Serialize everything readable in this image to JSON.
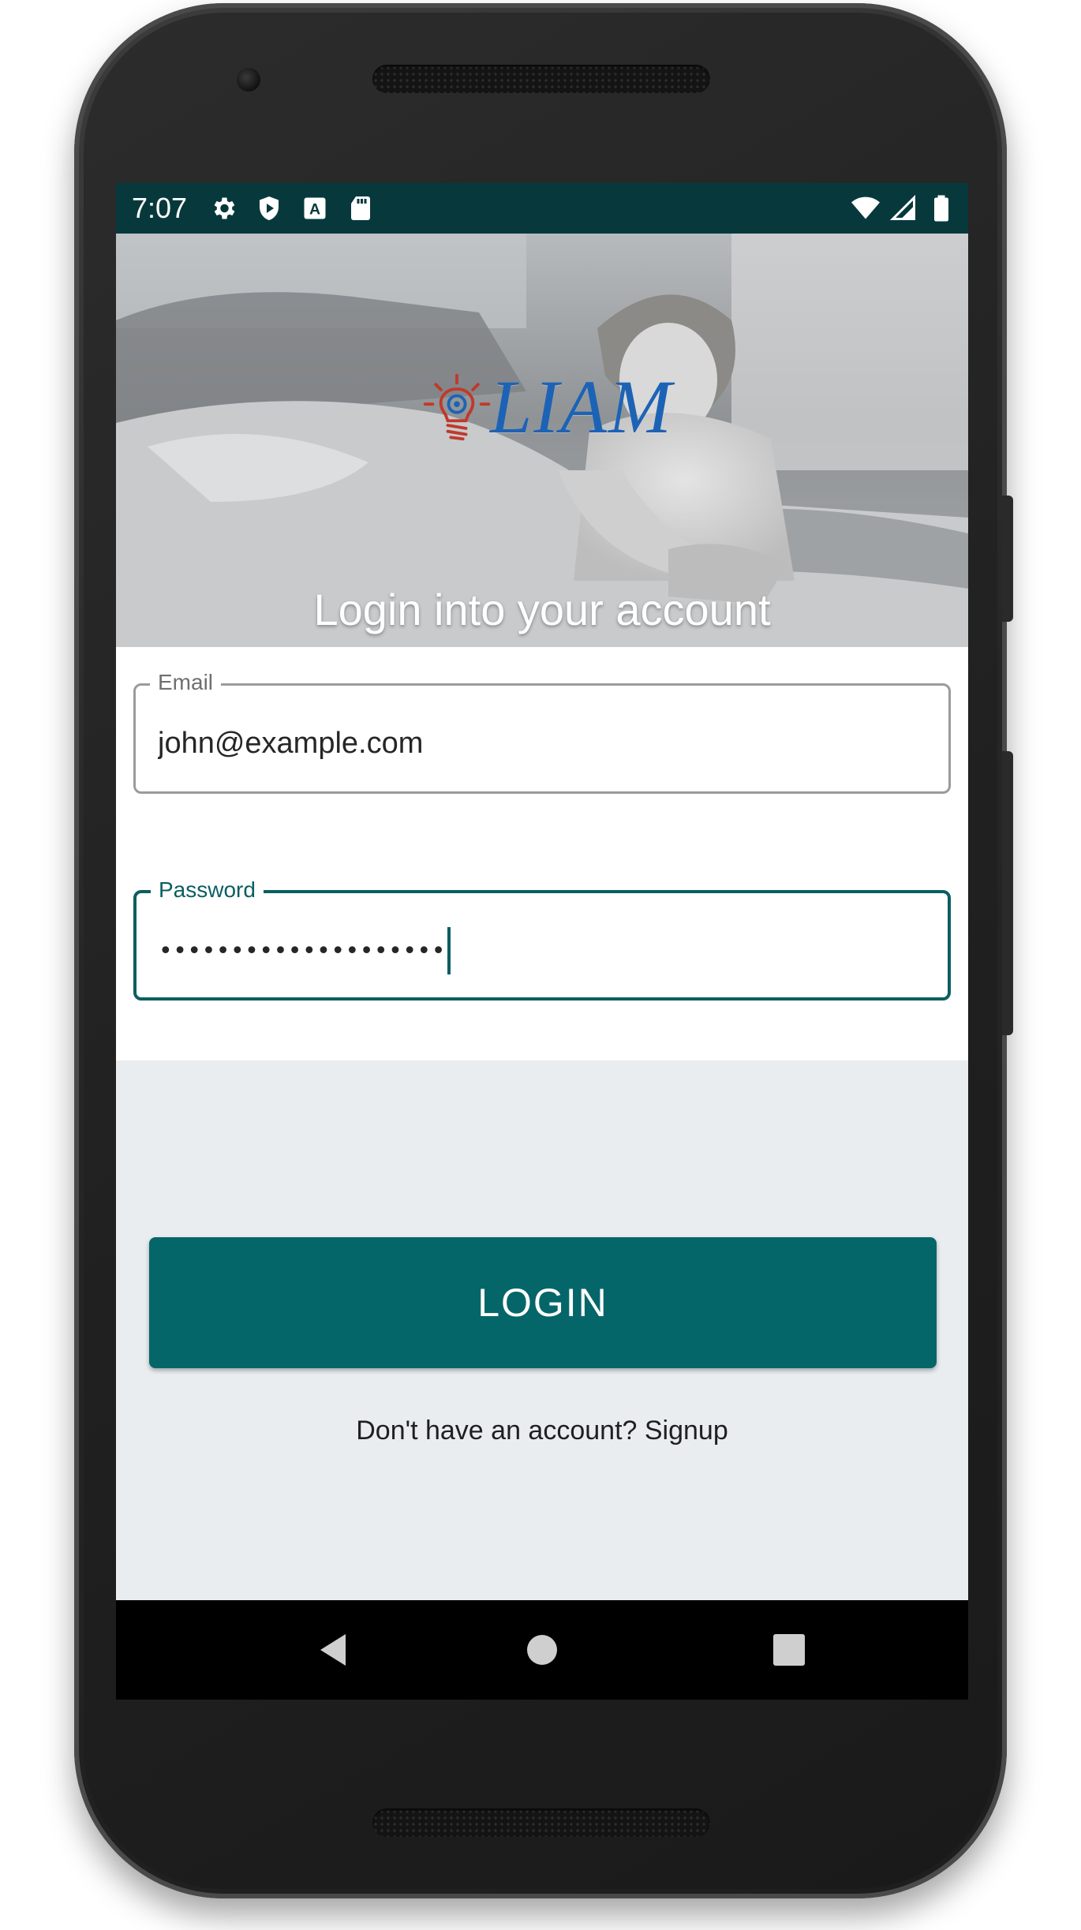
{
  "status_bar": {
    "time": "7:07",
    "left_icons": [
      "gear-icon",
      "shield-icon",
      "font-icon",
      "sd-card-icon"
    ],
    "right_icons": [
      "wifi-icon",
      "signal-icon",
      "battery-icon"
    ],
    "background_color": "#07393c"
  },
  "header": {
    "logo_text": "LIAM",
    "title": "Login into your account"
  },
  "form": {
    "email": {
      "label": "Email",
      "value": "john@example.com"
    },
    "password": {
      "label": "Password",
      "masked_value": "••••••••••••••••••••",
      "focused": true
    }
  },
  "actions": {
    "login_label": "LOGIN",
    "signup_prompt": "Don't have an account? Signup"
  },
  "nav_bar": {
    "buttons": [
      "back-icon",
      "home-icon",
      "recents-icon"
    ]
  },
  "colors": {
    "accent": "#05666a",
    "focus_border": "#0b5e62",
    "logo_blue": "#1d63b5",
    "logo_red": "#c0392b",
    "page_background": "#e9edf0"
  }
}
